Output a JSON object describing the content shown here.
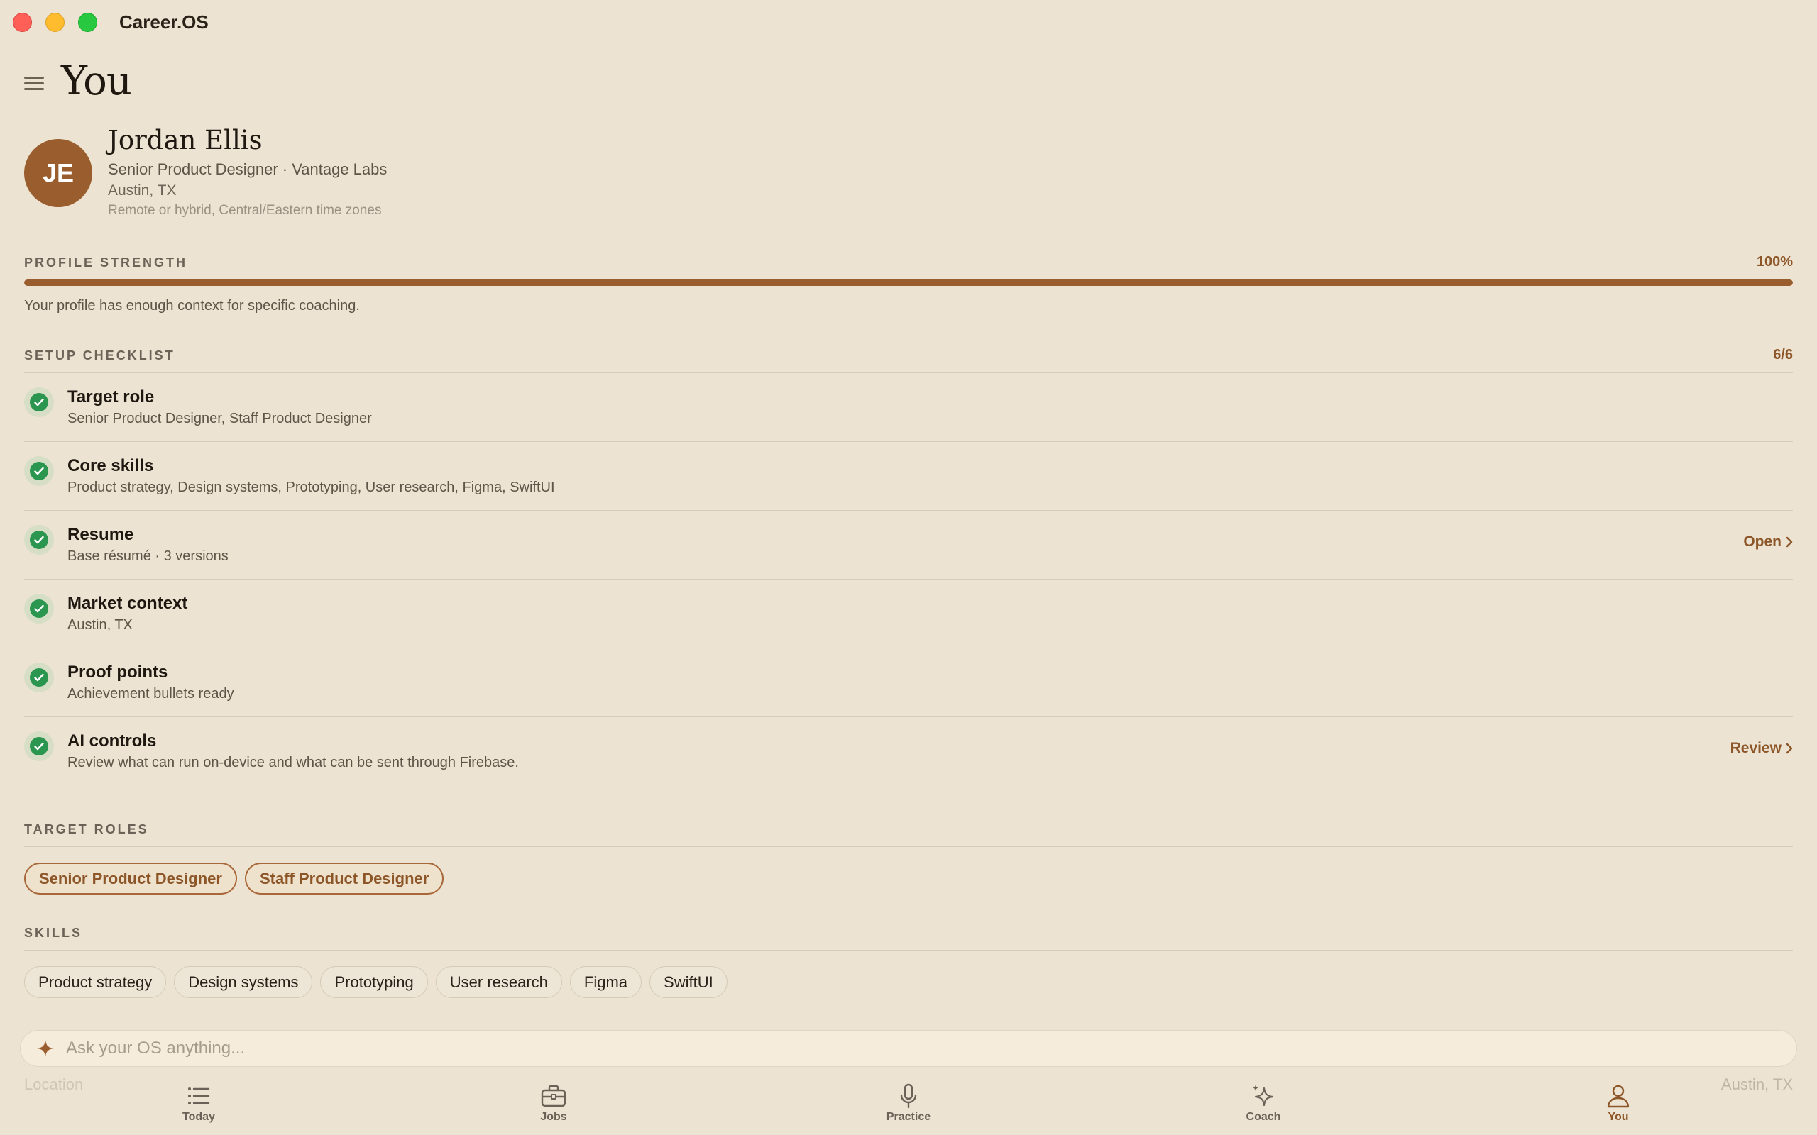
{
  "app": {
    "title": "Career.OS"
  },
  "page": {
    "title": "You"
  },
  "profile": {
    "initials": "JE",
    "name": "Jordan Ellis",
    "role_line": "Senior Product Designer · Vantage Labs",
    "location": "Austin, TX",
    "preference": "Remote or hybrid, Central/Eastern time zones"
  },
  "strength": {
    "label": "PROFILE STRENGTH",
    "value_text": "100%",
    "value": 1.0,
    "note": "Your profile has enough context for specific coaching."
  },
  "checklist": {
    "label": "SETUP CHECKLIST",
    "count": "6/6",
    "items": [
      {
        "title": "Target role",
        "subtitle": "Senior Product Designer, Staff Product Designer",
        "action": "",
        "done": true
      },
      {
        "title": "Core skills",
        "subtitle": "Product strategy, Design systems, Prototyping, User research, Figma, SwiftUI",
        "action": "",
        "done": true
      },
      {
        "title": "Resume",
        "subtitle": "Base résumé · 3 versions",
        "action": "Open",
        "done": true
      },
      {
        "title": "Market context",
        "subtitle": "Austin, TX",
        "action": "",
        "done": true
      },
      {
        "title": "Proof points",
        "subtitle": "Achievement bullets ready",
        "action": "",
        "done": true
      },
      {
        "title": "AI controls",
        "subtitle": "Review what can run on-device and what can be sent through Firebase.",
        "action": "Review",
        "done": true
      }
    ]
  },
  "target_roles": {
    "label": "TARGET ROLES",
    "items": [
      "Senior Product Designer",
      "Staff Product Designer"
    ]
  },
  "skills": {
    "label": "SKILLS",
    "items": [
      "Product strategy",
      "Design systems",
      "Prototyping",
      "User research",
      "Figma",
      "SwiftUI"
    ]
  },
  "ask": {
    "placeholder": "Ask your OS anything..."
  },
  "background_row": {
    "left": "Location",
    "right": "Austin, TX"
  },
  "tabs": [
    {
      "label": "Today",
      "icon": "list-icon",
      "active": false
    },
    {
      "label": "Jobs",
      "icon": "briefcase-icon",
      "active": false
    },
    {
      "label": "Practice",
      "icon": "microphone-icon",
      "active": false
    },
    {
      "label": "Coach",
      "icon": "sparkles-icon",
      "active": false
    },
    {
      "label": "You",
      "icon": "person-icon",
      "active": true
    }
  ],
  "colors": {
    "background": "#ece3d2",
    "accent": "#9a5d2d",
    "success": "#2b9650"
  }
}
